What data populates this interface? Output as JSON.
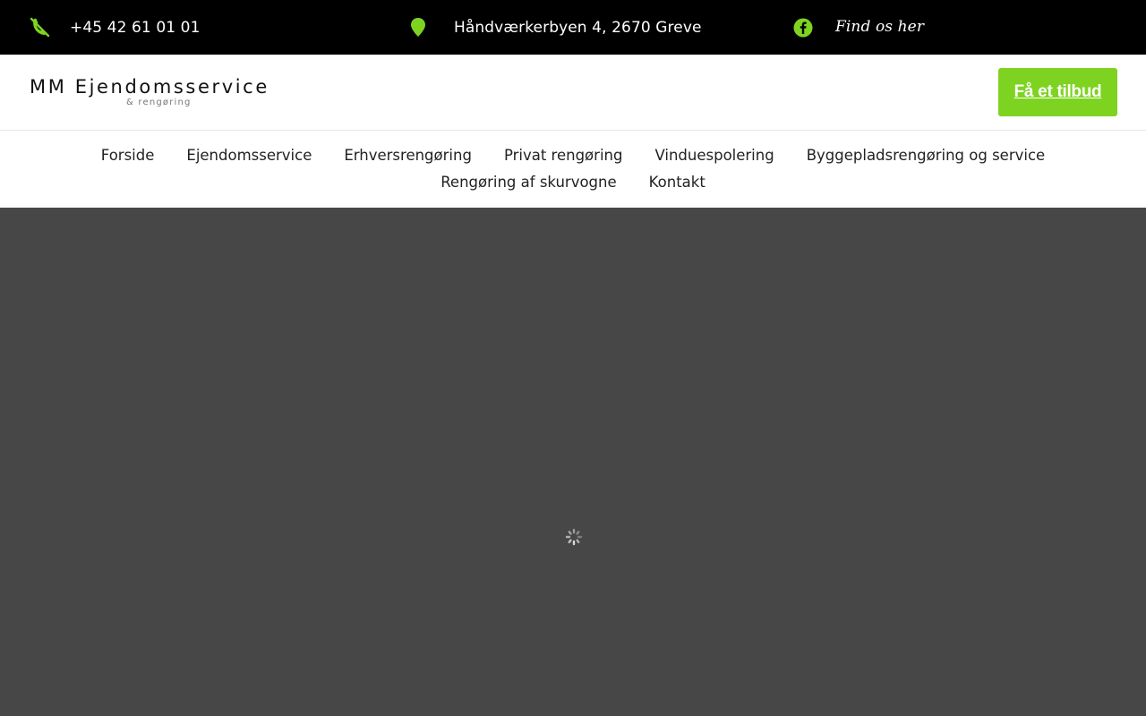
{
  "topbar": {
    "phone": "+45 42 61 01 01",
    "address": "Håndværkerbyen 4, 2670 Greve",
    "facebook_label": "Find os her",
    "phone_icon": "phone-icon",
    "address_icon": "map-pin-icon",
    "facebook_icon": "facebook-icon"
  },
  "header": {
    "logo_main": "MM Ejendomsservice",
    "logo_sub": "& rengøring",
    "cta_label": "Få et tilbud"
  },
  "nav": {
    "row1": [
      "Forside",
      "Ejendomsservice",
      "Erhversrengøring",
      "Privat rengøring",
      "Vinduespolering",
      "Byggepladsrengøring og service"
    ],
    "row2": [
      "Rengøring af skurvogne",
      "Kontakt"
    ]
  },
  "colors": {
    "accent": "#7ed321",
    "topbar_bg": "#000000",
    "content_bg": "#474747"
  },
  "main": {
    "loading_icon": "loading-spinner-icon"
  }
}
